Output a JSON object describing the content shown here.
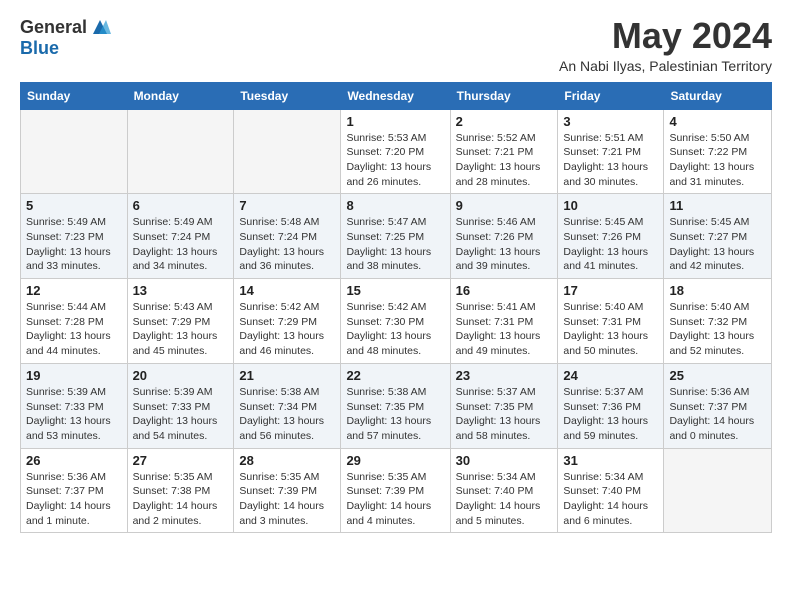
{
  "header": {
    "logo_general": "General",
    "logo_blue": "Blue",
    "month_title": "May 2024",
    "location": "An Nabi Ilyas, Palestinian Territory"
  },
  "days_of_week": [
    "Sunday",
    "Monday",
    "Tuesday",
    "Wednesday",
    "Thursday",
    "Friday",
    "Saturday"
  ],
  "weeks": [
    {
      "days": [
        {
          "number": "",
          "empty": true
        },
        {
          "number": "",
          "empty": true
        },
        {
          "number": "",
          "empty": true
        },
        {
          "number": "1",
          "sunrise": "5:53 AM",
          "sunset": "7:20 PM",
          "daylight": "13 hours and 26 minutes."
        },
        {
          "number": "2",
          "sunrise": "5:52 AM",
          "sunset": "7:21 PM",
          "daylight": "13 hours and 28 minutes."
        },
        {
          "number": "3",
          "sunrise": "5:51 AM",
          "sunset": "7:21 PM",
          "daylight": "13 hours and 30 minutes."
        },
        {
          "number": "4",
          "sunrise": "5:50 AM",
          "sunset": "7:22 PM",
          "daylight": "13 hours and 31 minutes."
        }
      ]
    },
    {
      "days": [
        {
          "number": "5",
          "sunrise": "5:49 AM",
          "sunset": "7:23 PM",
          "daylight": "13 hours and 33 minutes."
        },
        {
          "number": "6",
          "sunrise": "5:49 AM",
          "sunset": "7:24 PM",
          "daylight": "13 hours and 34 minutes."
        },
        {
          "number": "7",
          "sunrise": "5:48 AM",
          "sunset": "7:24 PM",
          "daylight": "13 hours and 36 minutes."
        },
        {
          "number": "8",
          "sunrise": "5:47 AM",
          "sunset": "7:25 PM",
          "daylight": "13 hours and 38 minutes."
        },
        {
          "number": "9",
          "sunrise": "5:46 AM",
          "sunset": "7:26 PM",
          "daylight": "13 hours and 39 minutes."
        },
        {
          "number": "10",
          "sunrise": "5:45 AM",
          "sunset": "7:26 PM",
          "daylight": "13 hours and 41 minutes."
        },
        {
          "number": "11",
          "sunrise": "5:45 AM",
          "sunset": "7:27 PM",
          "daylight": "13 hours and 42 minutes."
        }
      ]
    },
    {
      "days": [
        {
          "number": "12",
          "sunrise": "5:44 AM",
          "sunset": "7:28 PM",
          "daylight": "13 hours and 44 minutes."
        },
        {
          "number": "13",
          "sunrise": "5:43 AM",
          "sunset": "7:29 PM",
          "daylight": "13 hours and 45 minutes."
        },
        {
          "number": "14",
          "sunrise": "5:42 AM",
          "sunset": "7:29 PM",
          "daylight": "13 hours and 46 minutes."
        },
        {
          "number": "15",
          "sunrise": "5:42 AM",
          "sunset": "7:30 PM",
          "daylight": "13 hours and 48 minutes."
        },
        {
          "number": "16",
          "sunrise": "5:41 AM",
          "sunset": "7:31 PM",
          "daylight": "13 hours and 49 minutes."
        },
        {
          "number": "17",
          "sunrise": "5:40 AM",
          "sunset": "7:31 PM",
          "daylight": "13 hours and 50 minutes."
        },
        {
          "number": "18",
          "sunrise": "5:40 AM",
          "sunset": "7:32 PM",
          "daylight": "13 hours and 52 minutes."
        }
      ]
    },
    {
      "days": [
        {
          "number": "19",
          "sunrise": "5:39 AM",
          "sunset": "7:33 PM",
          "daylight": "13 hours and 53 minutes."
        },
        {
          "number": "20",
          "sunrise": "5:39 AM",
          "sunset": "7:33 PM",
          "daylight": "13 hours and 54 minutes."
        },
        {
          "number": "21",
          "sunrise": "5:38 AM",
          "sunset": "7:34 PM",
          "daylight": "13 hours and 56 minutes."
        },
        {
          "number": "22",
          "sunrise": "5:38 AM",
          "sunset": "7:35 PM",
          "daylight": "13 hours and 57 minutes."
        },
        {
          "number": "23",
          "sunrise": "5:37 AM",
          "sunset": "7:35 PM",
          "daylight": "13 hours and 58 minutes."
        },
        {
          "number": "24",
          "sunrise": "5:37 AM",
          "sunset": "7:36 PM",
          "daylight": "13 hours and 59 minutes."
        },
        {
          "number": "25",
          "sunrise": "5:36 AM",
          "sunset": "7:37 PM",
          "daylight": "14 hours and 0 minutes."
        }
      ]
    },
    {
      "days": [
        {
          "number": "26",
          "sunrise": "5:36 AM",
          "sunset": "7:37 PM",
          "daylight": "14 hours and 1 minute."
        },
        {
          "number": "27",
          "sunrise": "5:35 AM",
          "sunset": "7:38 PM",
          "daylight": "14 hours and 2 minutes."
        },
        {
          "number": "28",
          "sunrise": "5:35 AM",
          "sunset": "7:39 PM",
          "daylight": "14 hours and 3 minutes."
        },
        {
          "number": "29",
          "sunrise": "5:35 AM",
          "sunset": "7:39 PM",
          "daylight": "14 hours and 4 minutes."
        },
        {
          "number": "30",
          "sunrise": "5:34 AM",
          "sunset": "7:40 PM",
          "daylight": "14 hours and 5 minutes."
        },
        {
          "number": "31",
          "sunrise": "5:34 AM",
          "sunset": "7:40 PM",
          "daylight": "14 hours and 6 minutes."
        },
        {
          "number": "",
          "empty": true
        }
      ]
    }
  ],
  "labels": {
    "sunrise_prefix": "Sunrise: ",
    "sunset_prefix": "Sunset: ",
    "daylight_prefix": "Daylight: "
  }
}
